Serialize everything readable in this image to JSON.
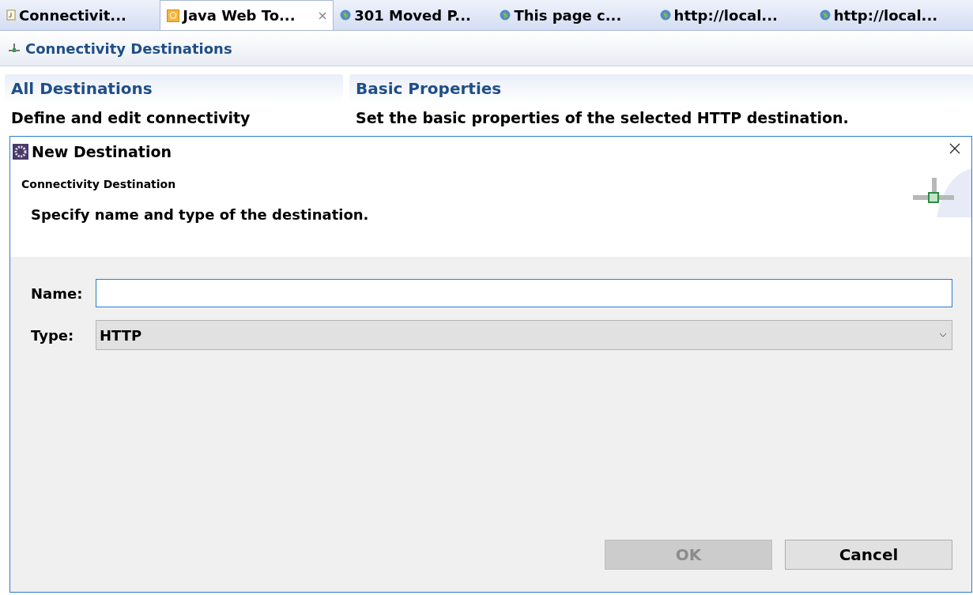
{
  "tabs": [
    {
      "label": "Connectivit...",
      "kind": "java",
      "selected": false,
      "closable": false
    },
    {
      "label": "Java Web To...",
      "kind": "web",
      "selected": true,
      "closable": true
    },
    {
      "label": "301 Moved P...",
      "kind": "globe",
      "selected": false,
      "closable": false
    },
    {
      "label": "This page c...",
      "kind": "globe",
      "selected": false,
      "closable": false
    },
    {
      "label": "http://local...",
      "kind": "globe",
      "selected": false,
      "closable": false
    },
    {
      "label": "http://local...",
      "kind": "globe",
      "selected": false,
      "closable": false
    }
  ],
  "editor": {
    "title": "Connectivity Destinations",
    "panels": [
      {
        "title": "All Destinations",
        "description": "Define and edit connectivity"
      },
      {
        "title": "Basic Properties",
        "description": "Set the basic properties of the selected HTTP destination."
      }
    ]
  },
  "dialog": {
    "title": "New Destination",
    "subtitle": "Connectivity Destination",
    "message": "Specify name and type of the destination.",
    "fields": [
      {
        "kind": "text",
        "label": "Name:"
      },
      {
        "kind": "select",
        "label": "Type:",
        "value": "HTTP"
      }
    ],
    "buttons": [
      {
        "label": "OK",
        "disabled": true
      },
      {
        "label": "Cancel",
        "disabled": false
      }
    ]
  }
}
